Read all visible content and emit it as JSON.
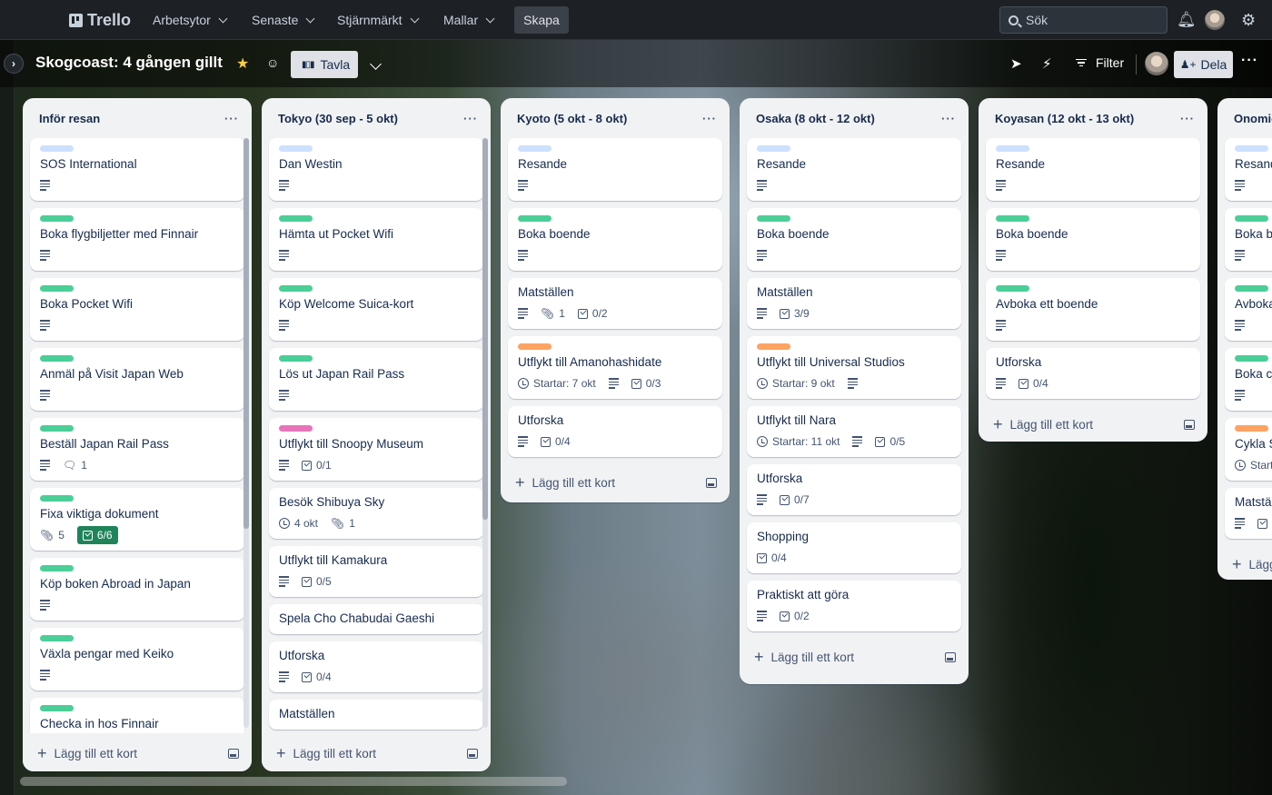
{
  "topnav": {
    "logo": "Trello",
    "menus": [
      {
        "label": "Arbetsytor"
      },
      {
        "label": "Senaste"
      },
      {
        "label": "Stjärnmärkt"
      },
      {
        "label": "Mallar"
      }
    ],
    "create_label": "Skapa",
    "search_placeholder": "Sök"
  },
  "board": {
    "title": "Skogcoast: 4 gången gillt",
    "view_label": "Tavla",
    "filter_label": "Filter",
    "share_label": "Dela"
  },
  "colors": {
    "label_blue": "#cce0ff",
    "label_green": "#4bce97",
    "label_orange": "#fea362",
    "label_pink": "#e774bb",
    "checklist_complete": "#1f845a"
  },
  "add_card_label": "Lägg till ett kort",
  "lists": [
    {
      "title": "Inför resan",
      "cards": [
        {
          "label": "blue",
          "title": "SOS International",
          "desc": true
        },
        {
          "label": "green",
          "title": "Boka flygbiljetter med Finnair",
          "desc": true
        },
        {
          "label": "green",
          "title": "Boka Pocket Wifi",
          "desc": true
        },
        {
          "label": "green",
          "title": "Anmäl på Visit Japan Web",
          "desc": true
        },
        {
          "label": "green",
          "title": "Beställ Japan Rail Pass",
          "desc": true,
          "comments": "1"
        },
        {
          "label": "green",
          "title": "Fixa viktiga dokument",
          "attachments": "5",
          "checklist": "6/6",
          "checklist_done": true
        },
        {
          "label": "green",
          "title": "Köp boken Abroad in Japan",
          "desc": true
        },
        {
          "label": "green",
          "title": "Växla pengar med Keiko",
          "desc": true
        },
        {
          "label": "green",
          "title": "Checka in hos Finnair"
        }
      ]
    },
    {
      "title": "Tokyo (30 sep - 5 okt)",
      "cards": [
        {
          "label": "blue",
          "title": "Dan Westin",
          "desc": true
        },
        {
          "label": "green",
          "title": "Hämta ut Pocket Wifi",
          "desc": true
        },
        {
          "label": "green",
          "title": "Köp Welcome Suica-kort",
          "desc": true
        },
        {
          "label": "green",
          "title": "Lös ut Japan Rail Pass",
          "desc": true
        },
        {
          "label": "pink",
          "title": "Utflykt till Snoopy Museum",
          "desc": true,
          "checklist": "0/1"
        },
        {
          "title": "Besök Shibuya Sky",
          "date": "4 okt",
          "attachments": "1"
        },
        {
          "title": "Utflykt till Kamakura",
          "desc": true,
          "checklist": "0/5"
        },
        {
          "title": "Spela Cho Chabudai Gaeshi"
        },
        {
          "title": "Utforska",
          "desc": true,
          "checklist": "0/4"
        },
        {
          "title": "Matställen"
        }
      ]
    },
    {
      "title": "Kyoto (5 okt - 8 okt)",
      "cards": [
        {
          "label": "blue",
          "title": "Resande",
          "desc": true
        },
        {
          "label": "green",
          "title": "Boka boende",
          "desc": true
        },
        {
          "title": "Matställen",
          "desc": true,
          "attachments": "1",
          "checklist": "0/2"
        },
        {
          "label": "orange",
          "title": "Utflykt till Amanohashidate",
          "date": "Startar: 7 okt",
          "desc": true,
          "checklist": "0/3"
        },
        {
          "title": "Utforska",
          "desc": true,
          "checklist": "0/4"
        }
      ]
    },
    {
      "title": "Osaka (8 okt - 12 okt)",
      "cards": [
        {
          "label": "blue",
          "title": "Resande",
          "desc": true
        },
        {
          "label": "green",
          "title": "Boka boende",
          "desc": true
        },
        {
          "title": "Matställen",
          "desc": true,
          "checklist": "3/9"
        },
        {
          "label": "orange",
          "title": "Utflykt till Universal Studios",
          "date": "Startar: 9 okt",
          "desc": true
        },
        {
          "title": "Utflykt till Nara",
          "date": "Startar: 11 okt",
          "desc": true,
          "checklist": "0/5"
        },
        {
          "title": "Utforska",
          "desc": true,
          "checklist": "0/7"
        },
        {
          "title": "Shopping",
          "checklist": "0/4"
        },
        {
          "title": "Praktiskt att göra",
          "desc": true,
          "checklist": "0/2"
        }
      ]
    },
    {
      "title": "Koyasan (12 okt - 13 okt)",
      "cards": [
        {
          "label": "blue",
          "title": "Resande",
          "desc": true
        },
        {
          "label": "green",
          "title": "Boka boende",
          "desc": true
        },
        {
          "label": "green",
          "title": "Avboka ett boende",
          "desc": true
        },
        {
          "title": "Utforska",
          "desc": true,
          "checklist": "0/4"
        }
      ]
    },
    {
      "title": "Onomichi",
      "cards": [
        {
          "label": "blue",
          "title": "Resande",
          "desc": true
        },
        {
          "label": "green",
          "title": "Boka boende",
          "desc": true
        },
        {
          "label": "green",
          "title": "Avboka ett boende",
          "desc": true
        },
        {
          "label": "green",
          "title": "Boka cyklar",
          "desc": true
        },
        {
          "label": "orange",
          "title": "Cykla Shimanami Kaido",
          "date": "Startar"
        },
        {
          "title": "Matställen",
          "desc": true,
          "checklist": ""
        }
      ]
    }
  ]
}
